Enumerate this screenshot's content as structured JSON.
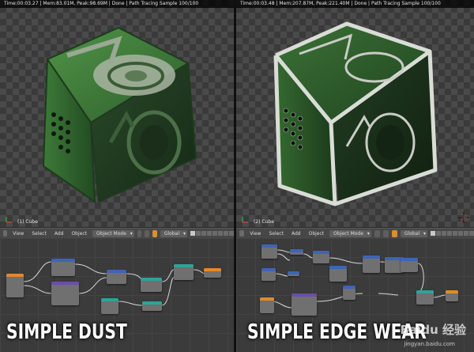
{
  "left": {
    "render_info": "Time:00:03.27 | Mem:83.01M, Peak:98.69M | Done | Path Tracing Sample 100/100",
    "object_name": "(1) Cube",
    "header": {
      "menus": [
        "View",
        "Select",
        "Add",
        "Object"
      ],
      "mode": "Object Mode",
      "orientation": "Global"
    },
    "caption": "SIMPLE DUST"
  },
  "right": {
    "render_info": "Time:00:03.48 | Mem:207.87M, Peak:221.40M | Done | Path Tracing Sample 100/100",
    "object_name": "(2) Cube",
    "header": {
      "menus": [
        "View",
        "Select",
        "Add",
        "Object"
      ],
      "mode": "Object Mode",
      "orientation": "Global"
    },
    "caption": "SIMPLE EDGE WEAR"
  },
  "watermark": {
    "brand": "Baidu 经验",
    "url": "jingyan.baidu.com"
  },
  "colors": {
    "cube_green": "#3f7a3a",
    "cube_dark": "#1f3a1f",
    "dust": "#b9c2b4",
    "edge_wear": "#d8dcd6",
    "node_header_blue": "#3f63b8",
    "node_header_teal": "#2ea39a",
    "node_header_orange": "#e08a2a",
    "node_header_purple": "#6b4ea8"
  }
}
